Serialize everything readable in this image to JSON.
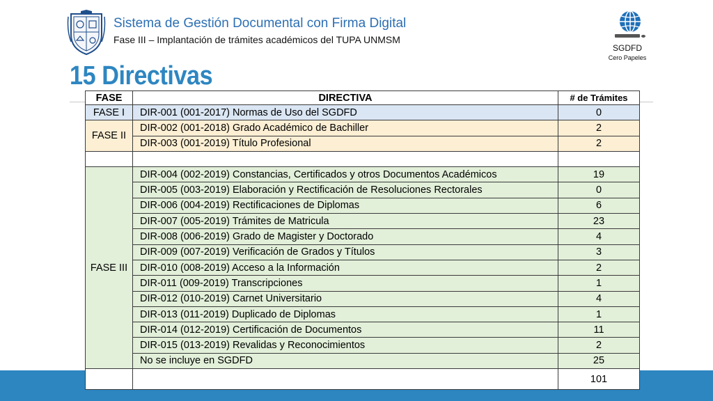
{
  "header": {
    "title": "Sistema de Gestión Documental con Firma Digital",
    "subtitle_bold": "Fase III –",
    "subtitle": " Implantación de trámites académicos del TUPA UNMSM"
  },
  "logo": {
    "name": "SGDFD",
    "tagline": "Cero Papeles"
  },
  "slide_title": "15 Directivas",
  "table": {
    "headers": {
      "fase": "FASE",
      "directiva": "DIRECTIVA",
      "tramites": "# de Trámites"
    },
    "phases": {
      "fase1": "FASE I",
      "fase2": "FASE II",
      "fase3": "FASE III"
    },
    "rows": [
      {
        "directiva": "DIR-001 (001-2017) Normas de Uso del SGDFD",
        "tramites": "0"
      },
      {
        "directiva": "DIR-002 (001-2018) Grado Académico de Bachiller",
        "tramites": "2"
      },
      {
        "directiva": "DIR-003 (001-2019) Título Profesional",
        "tramites": "2"
      },
      {
        "directiva": "DIR-004 (002-2019) Constancias, Certificados y otros Documentos Académicos",
        "tramites": "19"
      },
      {
        "directiva": "DIR-005 (003-2019) Elaboración y Rectificación de Resoluciones Rectorales",
        "tramites": "0"
      },
      {
        "directiva": "DIR-006 (004-2019) Rectificaciones de Diplomas",
        "tramites": "6"
      },
      {
        "directiva": "DIR-007 (005-2019) Trámites de Matricula",
        "tramites": "23"
      },
      {
        "directiva": "DIR-008 (006-2019) Grado de Magister y Doctorado",
        "tramites": "4"
      },
      {
        "directiva": "DIR-009 (007-2019) Verificación de Grados y Títulos",
        "tramites": "3"
      },
      {
        "directiva": "DIR-010 (008-2019) Acceso a la Información",
        "tramites": "2"
      },
      {
        "directiva": "DIR-011 (009-2019) Transcripciones",
        "tramites": "1"
      },
      {
        "directiva": "DIR-012 (010-2019) Carnet Universitario",
        "tramites": "4"
      },
      {
        "directiva": "DIR-013 (011-2019) Duplicado de Diplomas",
        "tramites": "1"
      },
      {
        "directiva": "DIR-014 (012-2019) Certificación de Documentos",
        "tramites": "11"
      },
      {
        "directiva": "DIR-015 (013-2019) Revalidas y Reconocimientos",
        "tramites": "2"
      },
      {
        "directiva": "No se incluye en SGDFD",
        "tramites": "25"
      }
    ],
    "total": "101"
  },
  "colors": {
    "accent": "#2e86c1",
    "fase1": "#dae6f3",
    "fase2": "#fcefd4",
    "fase3": "#e2efd9"
  }
}
